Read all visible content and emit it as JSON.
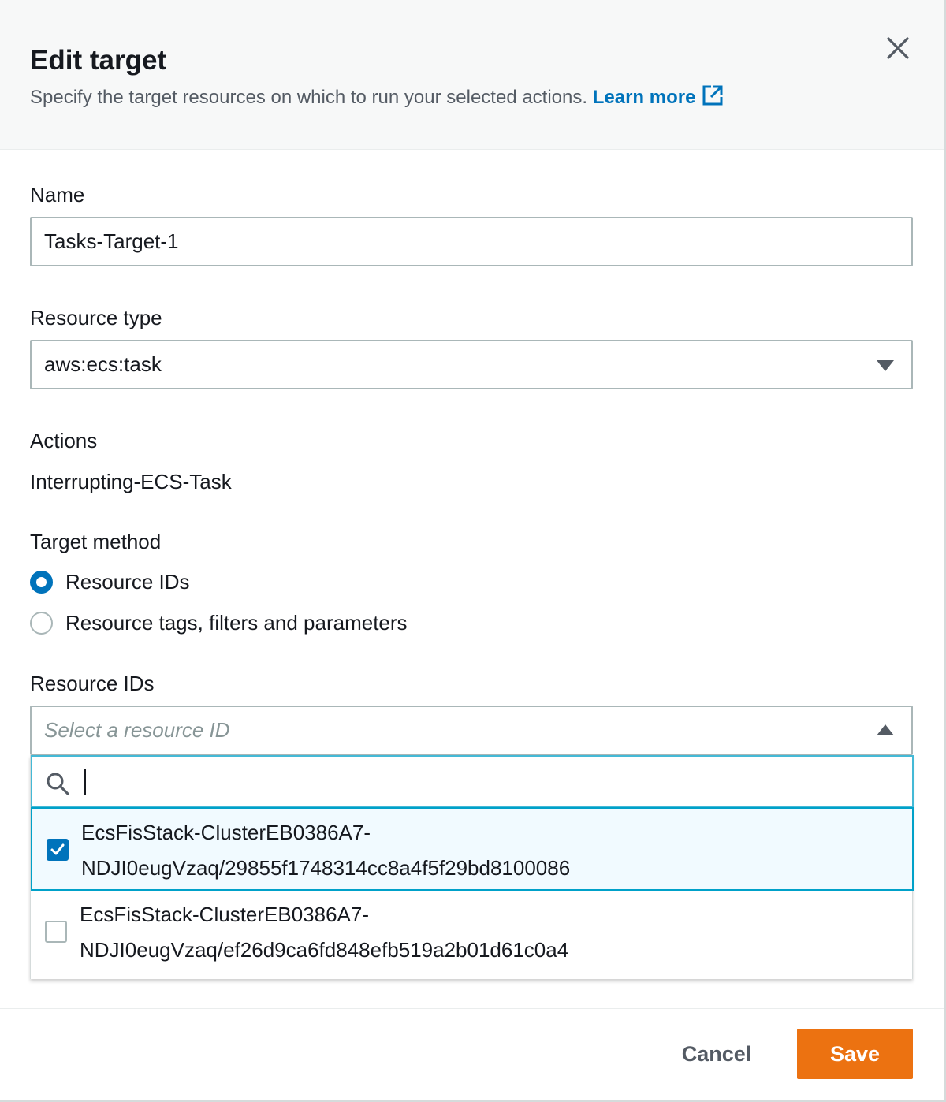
{
  "header": {
    "title": "Edit target",
    "subtitle": "Specify the target resources on which to run your selected actions.",
    "learn_more": "Learn more"
  },
  "form": {
    "name_label": "Name",
    "name_value": "Tasks-Target-1",
    "resource_type_label": "Resource type",
    "resource_type_value": "aws:ecs:task",
    "actions_label": "Actions",
    "actions_value": "Interrupting-ECS-Task",
    "target_method_label": "Target method",
    "target_method_options": [
      {
        "label": "Resource IDs",
        "selected": true
      },
      {
        "label": "Resource tags, filters and parameters",
        "selected": false
      }
    ],
    "resource_ids_label": "Resource IDs",
    "resource_ids_placeholder": "Select a resource ID",
    "filter_value": "",
    "resource_options": [
      {
        "line1": "EcsFisStack-ClusterEB0386A7-",
        "line2": "NDJI0eugVzaq/29855f1748314cc8a4f5f29bd8100086",
        "checked": true
      },
      {
        "line1": "EcsFisStack-ClusterEB0386A7-",
        "line2": "NDJI0eugVzaq/ef26d9ca6fd848efb519a2b01d61c0a4",
        "checked": false
      }
    ]
  },
  "footer": {
    "cancel_label": "Cancel",
    "save_label": "Save"
  },
  "colors": {
    "accent": "#0073bb",
    "primary_button": "#ec7211",
    "focus_border": "#44b9d6",
    "selected_option_bg": "#f1faff"
  },
  "icons": [
    "close-icon",
    "external-link-icon",
    "caret-down-icon",
    "caret-up-icon",
    "search-icon",
    "checkmark-icon"
  ]
}
